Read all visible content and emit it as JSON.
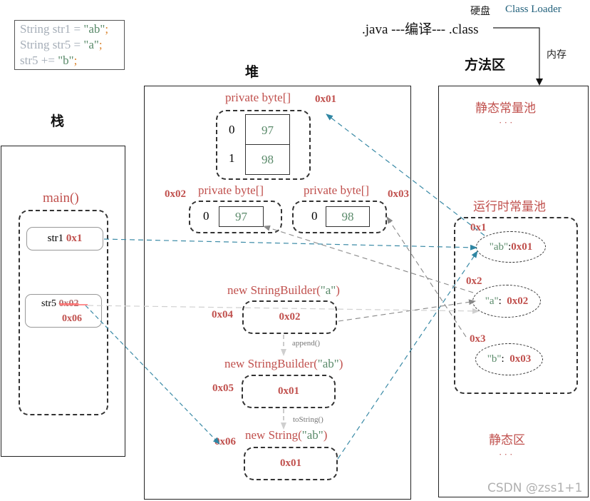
{
  "code_snippet": {
    "lines": [
      {
        "prefix": "String str1 = ",
        "literal": "\"ab\"",
        "suffix": ";"
      },
      {
        "prefix": "String str5 = ",
        "literal": "\"a\"",
        "suffix": ";"
      },
      {
        "prefix": "str5 += ",
        "literal": "\"b\"",
        "suffix": ";"
      }
    ]
  },
  "compile_flow": {
    "disk_label": "硬盘",
    "class_loader_label": "Class Loader",
    "flow_text": ".java ---编译--- .class",
    "memory_label": "内存"
  },
  "stack": {
    "title": "栈",
    "frame_label": "main()",
    "vars": [
      {
        "name": "str1",
        "address": "0x1"
      },
      {
        "name": "str5",
        "old_address": "0x02",
        "new_address": "0x06"
      }
    ]
  },
  "heap": {
    "title": "堆",
    "arrays": [
      {
        "label": "private byte[]",
        "address": "0x01",
        "cells": [
          {
            "index": "0",
            "value": "97"
          },
          {
            "index": "1",
            "value": "98"
          }
        ]
      },
      {
        "label": "private byte[]",
        "address": "0x02",
        "cells": [
          {
            "index": "0",
            "value": "97"
          }
        ]
      },
      {
        "label": "private byte[]",
        "address": "0x03",
        "cells": [
          {
            "index": "0",
            "value": "98"
          }
        ]
      }
    ],
    "objects": [
      {
        "label_prefix": "new StringBuilder(",
        "label_arg": "\"a\"",
        "label_suffix": ")",
        "address": "0x04",
        "content": "0x02"
      },
      {
        "label_prefix": "new StringBuilder(",
        "label_arg": "\"ab\"",
        "label_suffix": ")",
        "address": "0x05",
        "content": "0x01"
      },
      {
        "label_prefix": "new String(",
        "label_arg": "\"ab\"",
        "label_suffix": ")",
        "address": "0x06",
        "content": "0x01"
      }
    ],
    "transitions": [
      "append()",
      "toString()"
    ]
  },
  "method_area": {
    "title": "方法区",
    "static_pool_label": "静态常量池",
    "static_pool_ellipsis": "· · ·",
    "runtime_pool_label": "运行时常量池",
    "entries": [
      {
        "address": "0x1",
        "key": "\"ab\"",
        "value": "0x01"
      },
      {
        "address": "0x2",
        "key": "\"a\"",
        "value": "0x02"
      },
      {
        "address": "0x3",
        "key": "\"b\"",
        "value": "0x03"
      }
    ],
    "static_area_label": "静态区",
    "static_area_ellipsis": "· · ·"
  },
  "colors": {
    "address_red": "#c0504d",
    "value_green": "#5a8a6a",
    "arrow_teal": "#3a8aa6",
    "arrow_gray": "#8a8a8a",
    "arrow_light": "#d0d0d0"
  },
  "watermark": "CSDN @zss1+1"
}
